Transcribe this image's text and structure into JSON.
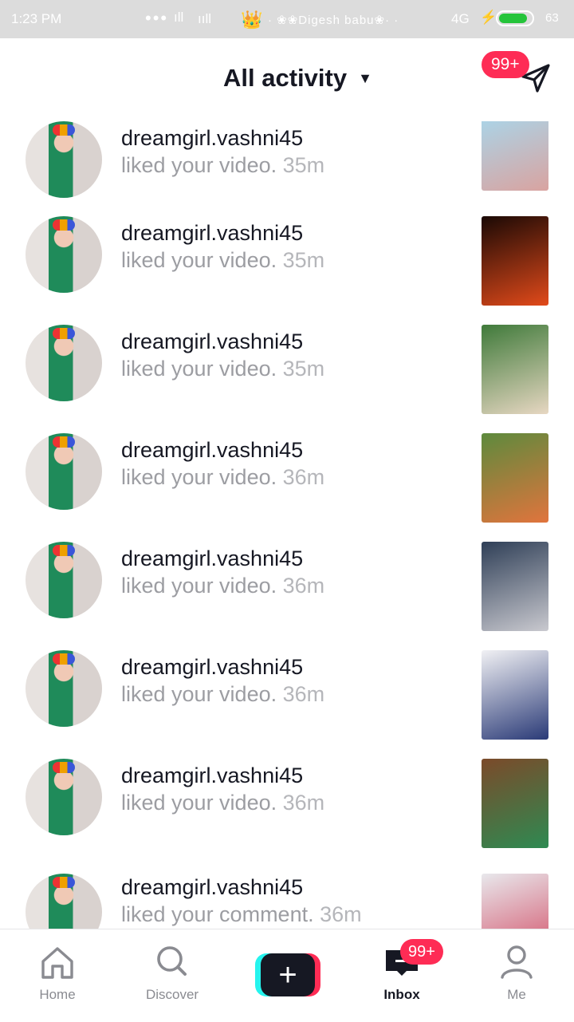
{
  "status_bar": {
    "time": "1:23 PM",
    "dots": "•••",
    "signal_1": "ıll",
    "signal_2": "ııll",
    "ticker": "· ❀❀Digesh  babu❀· ·",
    "network": "4G",
    "battery_text": "63",
    "battery_level": 0.8
  },
  "header": {
    "title": "All activity",
    "badge": "99+"
  },
  "notifications": [
    {
      "username": "dreamgirl.vashni45",
      "action": "liked your video.",
      "time": "35m",
      "thumb_colors": [
        "#a9d6ea",
        "#d9a3a0"
      ]
    },
    {
      "username": "dreamgirl.vashni45",
      "action": "liked your video.",
      "time": "35m",
      "thumb_colors": [
        "#1a0905",
        "#e24a1a"
      ]
    },
    {
      "username": "dreamgirl.vashni45",
      "action": "liked your video.",
      "time": "35m",
      "thumb_colors": [
        "#3f7a3a",
        "#e7d7c2"
      ]
    },
    {
      "username": "dreamgirl.vashni45",
      "action": "liked your video.",
      "time": "36m",
      "thumb_colors": [
        "#5d8a3d",
        "#e1743d"
      ]
    },
    {
      "username": "dreamgirl.vashni45",
      "action": "liked your video.",
      "time": "36m",
      "thumb_colors": [
        "#2f3f57",
        "#c9c9cf"
      ]
    },
    {
      "username": "dreamgirl.vashni45",
      "action": "liked your video.",
      "time": "36m",
      "thumb_colors": [
        "#f1f1f4",
        "#2a3a77"
      ]
    },
    {
      "username": "dreamgirl.vashni45",
      "action": "liked your video.",
      "time": "36m",
      "thumb_colors": [
        "#7b4a2a",
        "#2e8a52"
      ]
    },
    {
      "username": "dreamgirl.vashni45",
      "action": "liked your comment.",
      "time": "36m",
      "thumb_colors": [
        "#e8e8ec",
        "#d24a63"
      ]
    }
  ],
  "tabs": {
    "home": "Home",
    "discover": "Discover",
    "create": "+",
    "inbox": "Inbox",
    "me": "Me",
    "inbox_badge": "99+"
  },
  "colors": {
    "accent": "#fe2c55",
    "cyan": "#25f4ee",
    "text_primary": "#161823",
    "text_secondary": "#9c9da2"
  }
}
